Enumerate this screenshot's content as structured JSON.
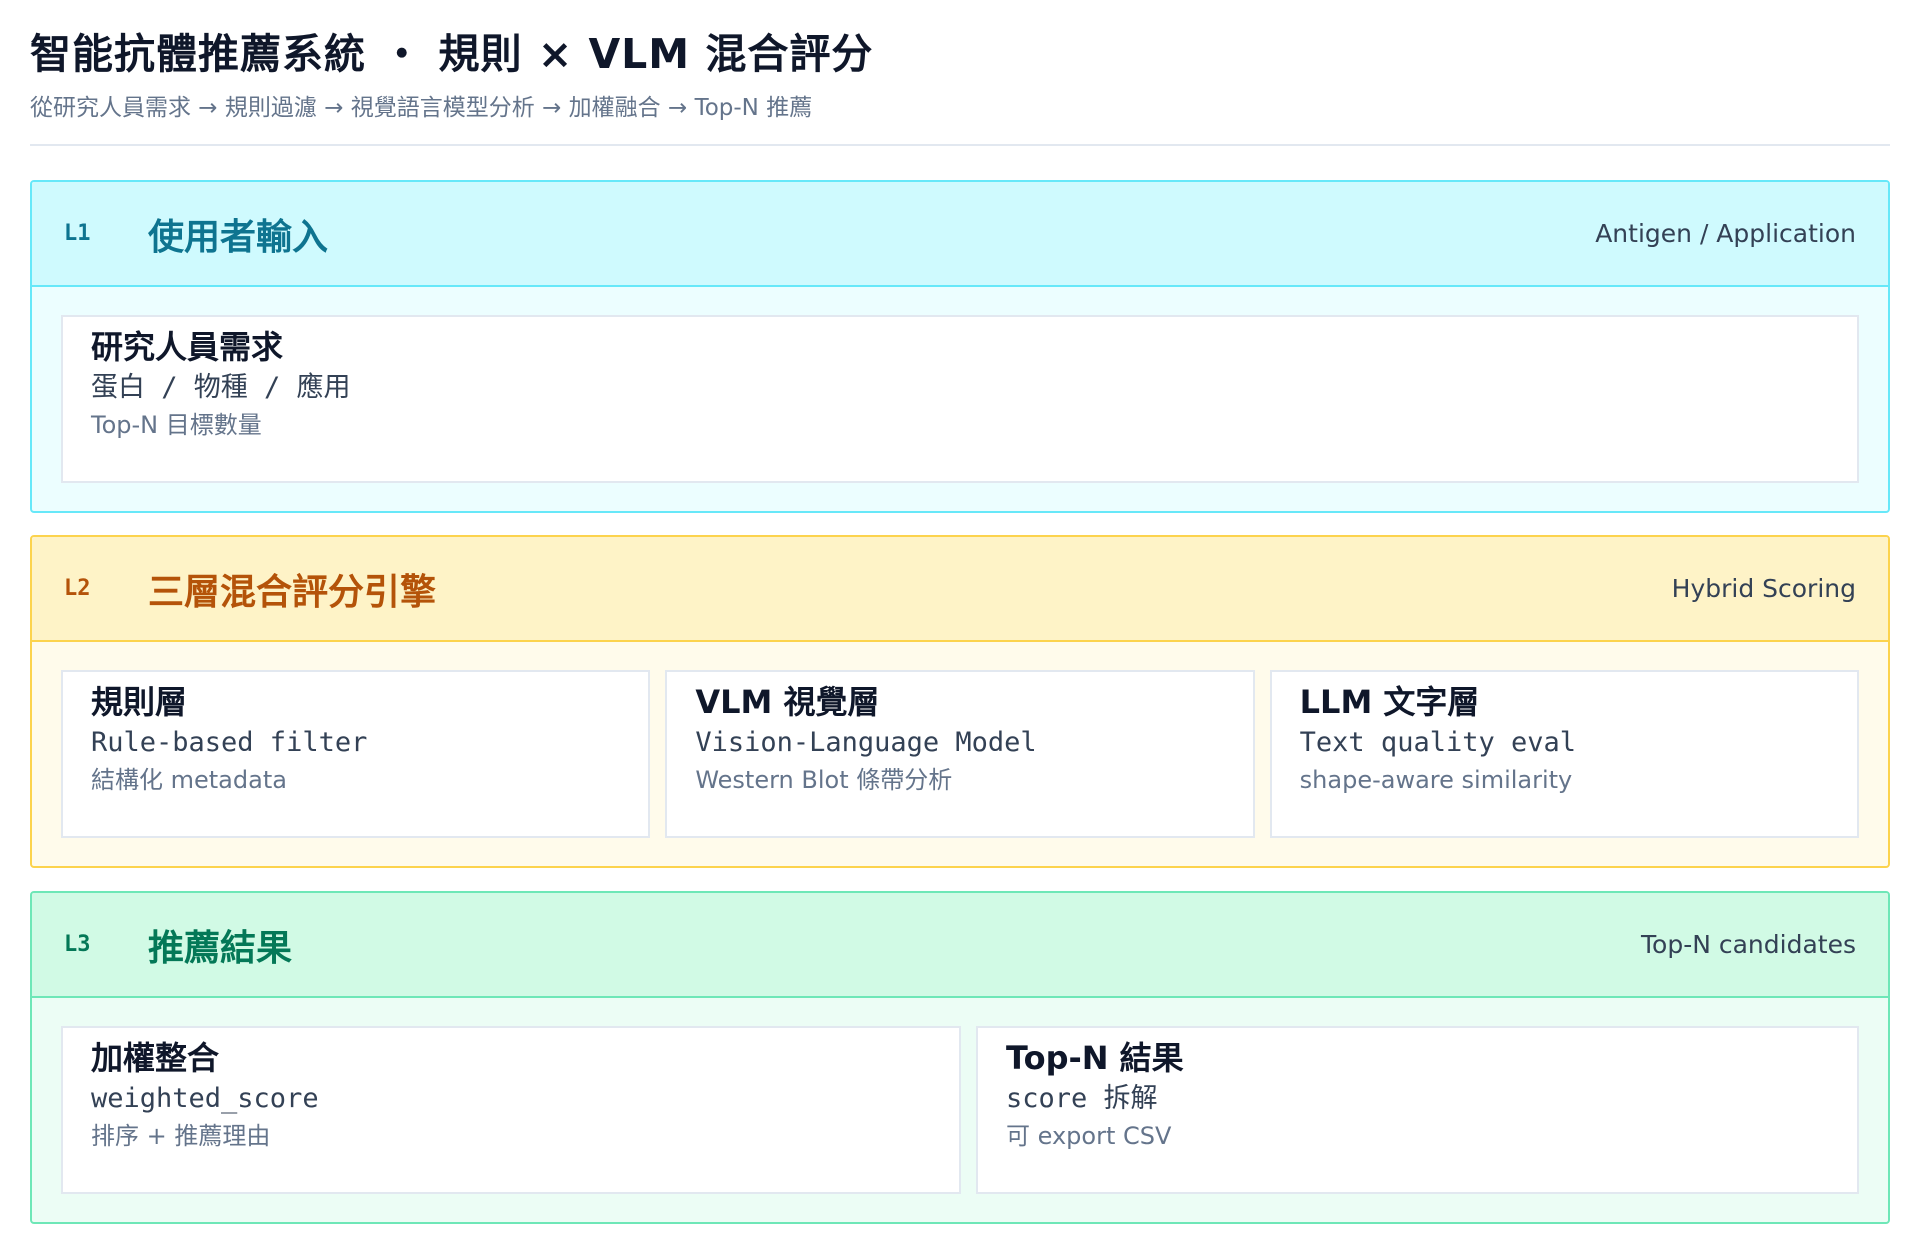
{
  "header": {
    "title": "智能抗體推薦系統 ・ 規則 × VLM 混合評分",
    "subtitle": "從研究人員需求 → 規則過濾 → 視覺語言模型分析 → 加權融合 → Top-N 推薦"
  },
  "layers": [
    {
      "code": "L1",
      "title": "使用者輸入",
      "tag": "Antigen / Application",
      "cards": [
        {
          "title": "研究人員需求",
          "mono": "蛋白 / 物種 / 應用",
          "note": "Top-N 目標數量"
        }
      ]
    },
    {
      "code": "L2",
      "title": "三層混合評分引擎",
      "tag": "Hybrid Scoring",
      "cards": [
        {
          "title": "規則層",
          "mono": "Rule-based filter",
          "note": "結構化 metadata"
        },
        {
          "title": "VLM 視覺層",
          "mono": "Vision-Language Model",
          "note": "Western Blot 條帶分析"
        },
        {
          "title": "LLM 文字層",
          "mono": "Text quality eval",
          "note": "shape-aware similarity"
        }
      ]
    },
    {
      "code": "L3",
      "title": "推薦結果",
      "tag": "Top-N candidates",
      "cards": [
        {
          "title": "加權整合",
          "mono": "weighted_score",
          "note": "排序 + 推薦理由"
        },
        {
          "title": "Top-N 結果",
          "mono": "score 拆解",
          "note": "可 export CSV"
        }
      ]
    }
  ]
}
